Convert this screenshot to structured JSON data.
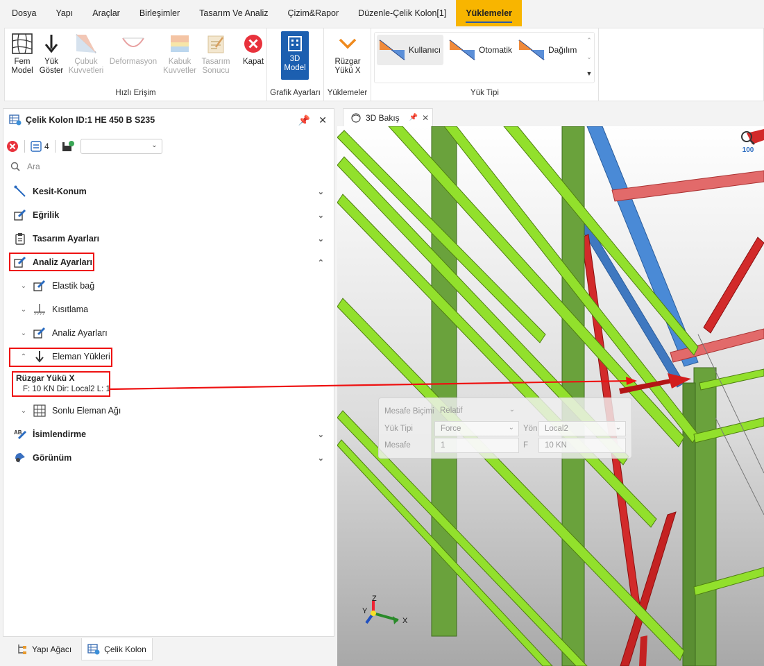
{
  "menu": [
    "Dosya",
    "Yapı",
    "Araçlar",
    "Birleşimler",
    "Tasarım Ve Analiz",
    "Çizim&Rapor",
    "Düzenle-Çelik Kolon[1]",
    "Yüklemeler"
  ],
  "ribbon": {
    "quick_access": {
      "label": "Hızlı Erişim",
      "buttons": [
        "Fem\nModel",
        "Yük\nGöster",
        "Çubuk\nKuvvetleri",
        "Deformasyon",
        "Kabuk\nKuvvetler",
        "Tasarım\nSonucu",
        "Kapat"
      ]
    },
    "graphic": {
      "label": "Grafik Ayarları",
      "button": "3D\nModel"
    },
    "loads": {
      "label": "Yüklemeler",
      "button": "Rüzgar\nYükü X"
    },
    "load_type": {
      "label": "Yük Tipi",
      "items": [
        "Kullanıcı",
        "Otomatik",
        "Dağılım"
      ]
    }
  },
  "panel": {
    "title": "Çelik Kolon ID:1 HE 450 B S235",
    "count": "4",
    "search_placeholder": "Ara",
    "sections": {
      "kesit": "Kesit-Konum",
      "egrilik": "Eğrilik",
      "tasarim": "Tasarım Ayarları",
      "analiz": "Analiz Ayarları",
      "isim": "İsimlendirme",
      "gorunum": "Görünüm"
    },
    "subitems": {
      "elastik": "Elastik bağ",
      "kisit": "Kısıtlama",
      "analiz": "Analiz Ayarları",
      "eleman": "Eleman Yükleri",
      "sonlu": "Sonlu Eleman Ağı"
    },
    "load": {
      "title": "Rüzgar Yükü X",
      "desc": "F: 10 KN Dir: Local2 L: 1"
    }
  },
  "bottom_tabs": [
    "Yapı Ağacı",
    "Çelik Kolon"
  ],
  "view": {
    "tab": "3D Bakış",
    "zoom": "100"
  },
  "dialog": {
    "mesafe_bicimi_label": "Mesafe Biçimi",
    "mesafe_bicimi": "Relatif",
    "yuk_tipi_label": "Yük Tipi",
    "yuk_tipi": "Force",
    "yon_label": "Yön",
    "yon": "Local2",
    "mesafe_label": "Mesafe",
    "mesafe": "1",
    "f_label": "F",
    "f": "10 KN"
  },
  "axes": {
    "x": "X",
    "y": "Y",
    "z": "Z"
  },
  "colors": {
    "accent": "#f8b500",
    "highlight": "#e11111",
    "beam": "#8fdc2a",
    "column": "#6aa23c",
    "brace": "#d42020",
    "rafter": "#4f8fd6"
  }
}
